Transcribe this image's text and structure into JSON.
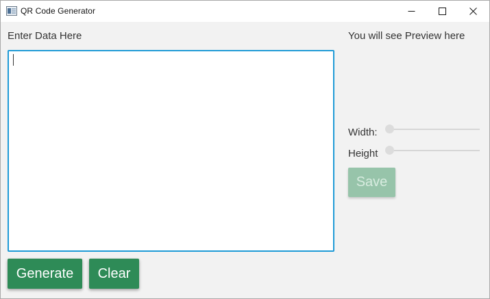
{
  "window": {
    "title": "QR Code Generator",
    "controls": [
      "minimize",
      "maximize",
      "close"
    ]
  },
  "input": {
    "label": "Enter Data Here",
    "value": ""
  },
  "preview": {
    "label": "You will see Preview here"
  },
  "size": {
    "width_label": "Width:",
    "height_label": "Height",
    "width_value": 0,
    "height_value": 0
  },
  "buttons": {
    "generate": "Generate",
    "clear": "Clear",
    "save": "Save",
    "save_enabled": false
  },
  "colors": {
    "accent": "#2e8b57",
    "focus_border": "#1e9ad6",
    "disabled_button": "#97c4aa"
  }
}
